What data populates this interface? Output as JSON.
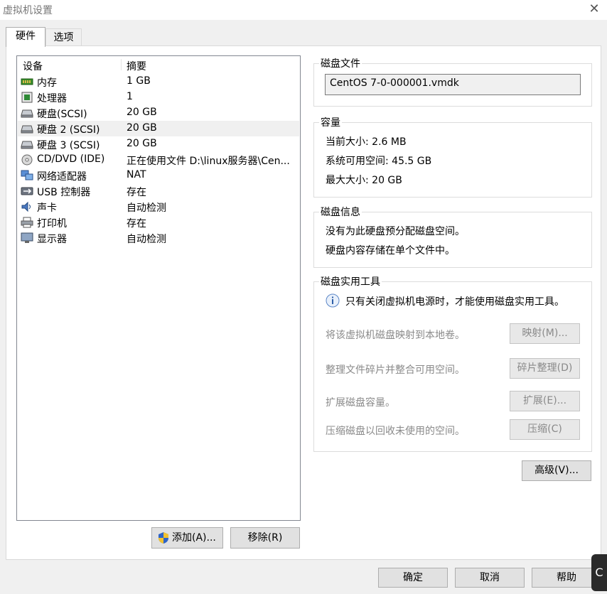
{
  "window": {
    "title": "虚拟机设置"
  },
  "tabs": [
    {
      "label": "硬件",
      "active": true
    },
    {
      "label": "选项",
      "active": false
    }
  ],
  "device_list": {
    "columns": [
      "设备",
      "摘要"
    ],
    "rows": [
      {
        "name": "内存",
        "summary": "1 GB",
        "icon": "memory-icon",
        "selected": false
      },
      {
        "name": "处理器",
        "summary": "1",
        "icon": "processor-icon",
        "selected": false
      },
      {
        "name": "硬盘(SCSI)",
        "summary": "20 GB",
        "icon": "hard-disk-icon",
        "selected": false
      },
      {
        "name": "硬盘 2 (SCSI)",
        "summary": "20 GB",
        "icon": "hard-disk-icon",
        "selected": true
      },
      {
        "name": "硬盘 3 (SCSI)",
        "summary": "20 GB",
        "icon": "hard-disk-icon",
        "selected": false
      },
      {
        "name": "CD/DVD (IDE)",
        "summary": "正在使用文件 D:\\linux服务器\\Cen...",
        "icon": "cd-dvd-icon",
        "selected": false
      },
      {
        "name": "网络适配器",
        "summary": "NAT",
        "icon": "network-adapter-icon",
        "selected": false
      },
      {
        "name": "USB 控制器",
        "summary": "存在",
        "icon": "usb-icon",
        "selected": false
      },
      {
        "name": "声卡",
        "summary": "自动检测",
        "icon": "sound-card-icon",
        "selected": false
      },
      {
        "name": "打印机",
        "summary": "存在",
        "icon": "printer-icon",
        "selected": false
      },
      {
        "name": "显示器",
        "summary": "自动检测",
        "icon": "display-icon",
        "selected": false
      }
    ]
  },
  "list_buttons": {
    "add": "添加(A)...",
    "remove": "移除(R)"
  },
  "disk_file": {
    "label": "磁盘文件",
    "value": "CentOS 7-0-000001.vmdk"
  },
  "capacity": {
    "label": "容量",
    "current": "当前大小: 2.6 MB",
    "available": "系统可用空间: 45.5 GB",
    "max": "最大大小: 20 GB"
  },
  "disk_info": {
    "label": "磁盘信息",
    "line1": "没有为此硬盘预分配磁盘空间。",
    "line2": "硬盘内容存储在单个文件中。"
  },
  "utilities": {
    "label": "磁盘实用工具",
    "notice": "只有关闭虚拟机电源时，才能使用磁盘实用工具。",
    "map_text": "将该虚拟机磁盘映射到本地卷。",
    "map_btn": "映射(M)...",
    "defrag_text": "整理文件碎片并整合可用空间。",
    "defrag_btn": "碎片整理(D)",
    "expand_text": "扩展磁盘容量。",
    "expand_btn": "扩展(E)...",
    "compact_text": "压缩磁盘以回收未使用的空间。",
    "compact_btn": "压缩(C)"
  },
  "advanced_btn": "高级(V)...",
  "footer": {
    "ok": "确定",
    "cancel": "取消",
    "help": "帮助"
  },
  "corner_glyph": "C"
}
